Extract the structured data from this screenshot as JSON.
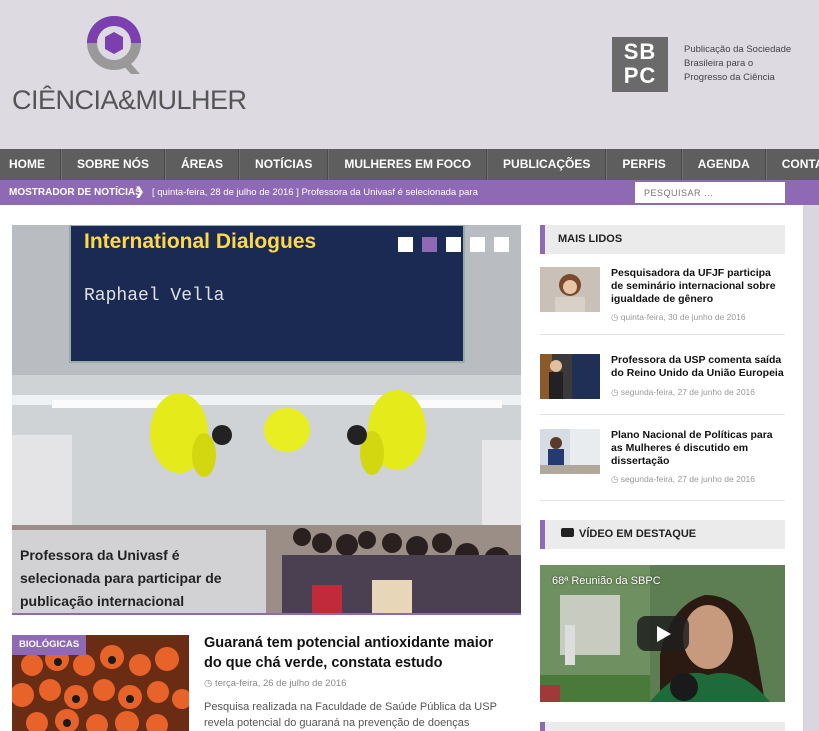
{
  "site": {
    "logo_text": "CIÊNCIA&MULHER",
    "sbpc_logo_line1": "SB",
    "sbpc_logo_line2": "PC",
    "sbpc_caption": "Publicação da Sociedade Brasileira para o Progresso da Ciência",
    "colors": {
      "accent": "#8e6ab5",
      "nav": "#5e5e5e",
      "header_bg": "#dddae2"
    }
  },
  "nav": {
    "items": [
      "HOME",
      "SOBRE NÓS",
      "ÁREAS",
      "NOTÍCIAS",
      "MULHERES EM FOCO",
      "PUBLICAÇÕES",
      "PERFIS",
      "AGENDA",
      "CONTATO"
    ]
  },
  "ticker": {
    "label": "MOSTRADOR DE NOTÍCIAS",
    "arrow": "❯",
    "text": "[ quinta-feira, 28 de julho de 2016 ]  Professora da Univasf é selecionada para"
  },
  "search": {
    "placeholder": "PESQUISAR ..."
  },
  "slider": {
    "slide_text_line1": "International Dialogues",
    "slide_text_line2": "Raphael Vella",
    "caption": "Professora da Univasf é selecionada para participar de publicação internacional",
    "dot_count": 5,
    "active_dot": 2
  },
  "article": {
    "badge": "BIOLÓGICAS",
    "title": "Guaraná tem potencial antioxidante maior do que chá verde, constata estudo",
    "date": "terça-feira, 26 de julho de 2016",
    "excerpt": "Pesquisa realizada na Faculdade de Saúde Pública da USP revela potencial do guaraná na prevenção de doenças"
  },
  "sidebar": {
    "mais_lidos_title": "MAIS LIDOS",
    "mais_lidos": [
      {
        "title": "Pesquisadora da UFJF participa de seminário internacional sobre igualdade de gênero",
        "date": "quinta-feira, 30 de junho de 2016"
      },
      {
        "title": "Professora da USP comenta saída do Reino Unido da União Europeia",
        "date": "segunda-feira, 27 de junho de 2016"
      },
      {
        "title": "Plano Nacional de Políticas para as Mulheres é discutido em dissertação",
        "date": "segunda-feira, 27 de junho de 2016"
      }
    ],
    "video_title": "VÍDEO EM DESTAQUE",
    "video_caption": "68ª Reunião da SBPC"
  }
}
